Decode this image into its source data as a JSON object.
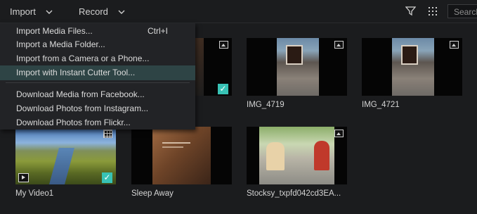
{
  "toolbar": {
    "import_label": "Import",
    "record_label": "Record",
    "search_placeholder": "Search",
    "icons": [
      "filter-icon",
      "grid-view-icon",
      "chevron-down-icon"
    ]
  },
  "import_menu": {
    "items": [
      {
        "label": "Import Media Files...",
        "shortcut": "Ctrl+I"
      },
      {
        "label": "Import a Media Folder..."
      },
      {
        "label": "Import from a Camera or a Phone..."
      },
      {
        "label": "Import with Instant Cutter Tool...",
        "highlighted": true
      },
      {
        "label": "Download Media from Facebook..."
      },
      {
        "label": "Download Photos from Instagram..."
      },
      {
        "label": "Download Photos from Flickr..."
      }
    ]
  },
  "media": [
    {
      "name": "",
      "type": "image",
      "selected": true
    },
    {
      "name": "IMG_4719",
      "type": "image",
      "selected": false
    },
    {
      "name": "IMG_4721",
      "type": "image",
      "selected": false
    },
    {
      "name": "My Video1",
      "type": "video",
      "selected": true
    },
    {
      "name": "Sleep Away",
      "type": "audio",
      "selected": false
    },
    {
      "name": "Stocksy_txpfd042cd3EA...",
      "type": "image",
      "selected": false
    }
  ],
  "colors": {
    "accent_check": "#38c2b5",
    "menu_highlight": "#2e4445",
    "background": "#1b1c1e"
  }
}
